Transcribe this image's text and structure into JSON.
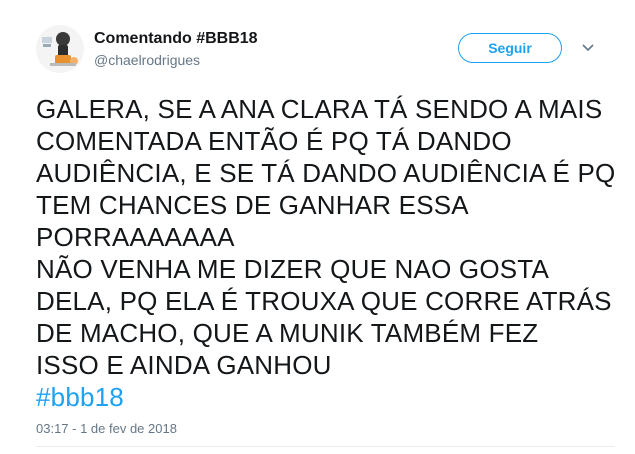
{
  "tweet": {
    "user": {
      "name": "Comentando #BBB18",
      "handle": "@chaelrodrigues"
    },
    "follow_label": "Seguir",
    "body_lines": [
      "GALERA, SE A ANA CLARA TÁ SENDO A MAIS",
      "COMENTADA ENTÃO É PQ TÁ DANDO",
      "AUDIÊNCIA, E SE TÁ DANDO AUDIÊNCIA É PQ",
      "TEM CHANCES DE GANHAR ESSA",
      "PORRAAAAAAA",
      "NÃO VENHA ME DIZER QUE NAO GOSTA",
      "DELA, PQ ELA É TROUXA QUE CORRE ATRÁS",
      "DE MACHO, QUE  A MUNIK TAMBÉM FEZ",
      "ISSO E AINDA GANHOU"
    ],
    "hashtag": "#bbb18",
    "timestamp": "03:17 - 1 de fev de 2018"
  },
  "colors": {
    "accent": "#1da1f2",
    "text": "#14171a",
    "muted": "#657786"
  },
  "icons": {
    "avatar": "cartoon-avatar-icon",
    "caret": "chevron-down-icon"
  }
}
